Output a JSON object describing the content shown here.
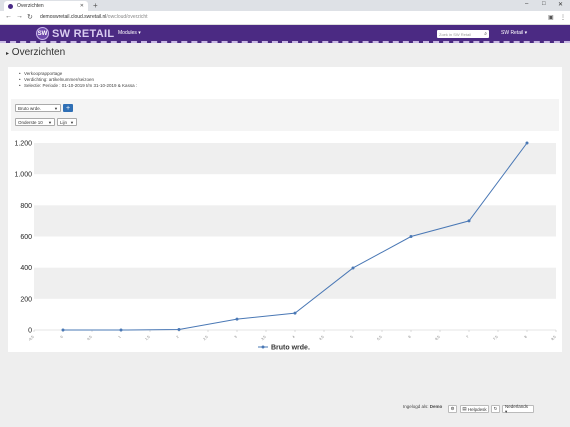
{
  "browser": {
    "tab_title": "Overzichten",
    "url_host": "demoswretail.cloud.swretail.nl",
    "url_path": "/owcloud/overzicht"
  },
  "app": {
    "logo_initials": "SW",
    "logo_text": "SW RETAIL",
    "modules_label": "Modules ▾",
    "search_placeholder": "Zoek in SW Retail",
    "user_label": "SW Retail ▾"
  },
  "page": {
    "title": "Overzichten",
    "info": [
      "Verkooprapportage",
      "Verdichting: artikelnummer/seizoen",
      "Selectie: Periode : 01-10-2019 t/m 31-10-2019 & Kassa :"
    ],
    "controls": {
      "measure_select": "Bruto wrde.",
      "add_button": "+",
      "order_select": "Onderste 10",
      "charttype_select": "Lijn"
    }
  },
  "chart_data": {
    "type": "line",
    "x": [
      0,
      1,
      2,
      3,
      4,
      5,
      6,
      7,
      8
    ],
    "series": [
      {
        "name": "Bruto wrde.",
        "values": [
          0,
          0,
          3,
          70,
          108,
          398,
          600,
          700,
          1200
        ]
      }
    ],
    "y_ticks": [
      "0",
      "200",
      "400",
      "600",
      "800",
      "1.000",
      "1.200"
    ],
    "ylim": [
      0,
      1200
    ],
    "xlim": [
      -0.5,
      8.5
    ],
    "x_ticks": [
      "-0,5",
      "0",
      "0,5",
      "1",
      "1,5",
      "2",
      "2,5",
      "3",
      "3,5",
      "4",
      "4,5",
      "5",
      "5,5",
      "6",
      "6,5",
      "7",
      "7,5",
      "8",
      "8,5"
    ],
    "legend": "bottom-center",
    "grid": "alternating bands",
    "line_color": "#4a78b5"
  },
  "footer": {
    "logged_in_label": "Ingelogd als:",
    "user": "Demo",
    "help_label": "Helpdesk",
    "language": "Nederlands ▾"
  }
}
